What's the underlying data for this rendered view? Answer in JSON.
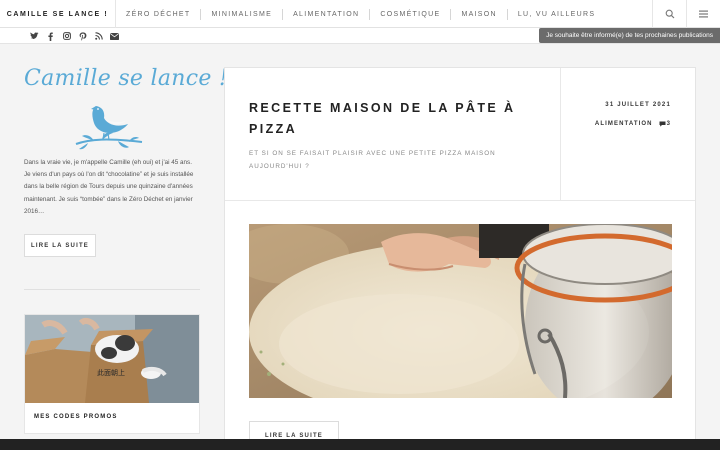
{
  "header": {
    "brand": "CAMILLE SE LANCE !",
    "menu": [
      "ZÉRO DÉCHET",
      "MINIMALISME",
      "ALIMENTATION",
      "COSMÉTIQUE",
      "MAISON",
      "LU, VU AILLEURS"
    ],
    "icons": [
      "search-icon",
      "menu-icon"
    ]
  },
  "social": {
    "icons": [
      "twitter-icon",
      "facebook-icon",
      "instagram-icon",
      "pinterest-icon",
      "rss-icon",
      "mail-icon"
    ],
    "subscribe_label": "Je souhaite être informé(e) de tes prochaines publications"
  },
  "sidebar": {
    "logo_text": "Camille se lance !",
    "about_text": "Dans la vraie vie, je m'appelle Camille (eh oui) et j'ai 45 ans. Je viens d'un pays où l'on dit “chocolatine” et je suis installée dans la belle région de Tours depuis une quinzaine d'années maintenant. Je suis “tombée” dans le Zéro Déchet en janvier 2016…",
    "read_more": "LIRE LA SUITE",
    "promo_label": "MES CODES PROMOS",
    "box_text": "此面朝上"
  },
  "post": {
    "title": "RECETTE MAISON DE LA PÂTE À PIZZA",
    "excerpt": "ET SI ON SE FAISAIT PLAISIR AVEC UNE PETITE PIZZA MAISON AUJOURD'HUI ?",
    "date": "31 JUILLET 2021",
    "category": "ALIMENTATION",
    "comments": "3",
    "read_more": "LIRE LA SUITE"
  },
  "colors": {
    "accent": "#5aaad6",
    "footer": "#222222",
    "subscribe_bg": "#6b6b6b"
  }
}
